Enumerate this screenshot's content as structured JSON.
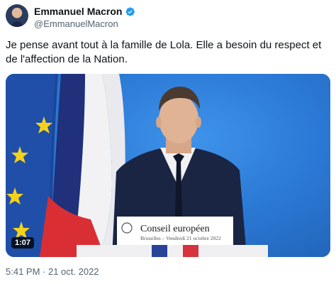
{
  "author": {
    "name": "Emmanuel Macron",
    "handle": "@EmmanuelMacron",
    "verified_icon": "verified-badge-icon",
    "badge_color": "#1d9bf0"
  },
  "tweet": {
    "text": "Je pense avant tout à la famille de Lola. Elle a besoin du respect et de l'affection de la Nation."
  },
  "media": {
    "duration": "1:07",
    "podium": {
      "title": "Conseil européen",
      "subtitle": "Bruxelles – Vendredi 21 octobre 2022"
    }
  },
  "meta": {
    "timestamp": "5:41 PM · 21 oct. 2022"
  }
}
